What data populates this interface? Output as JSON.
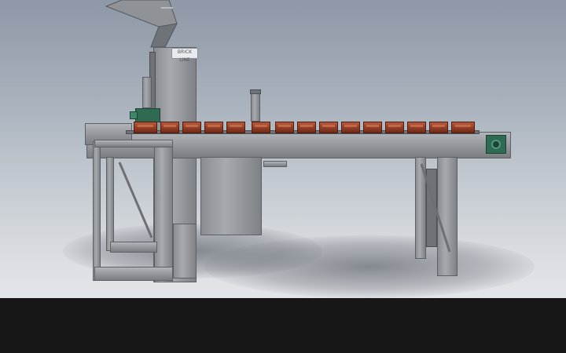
{
  "scene": {
    "description_free": true,
    "model_label": "BRICK LINE",
    "colors": {
      "sky_top": "#8e98a6",
      "sky_bottom": "#e3e6e9",
      "steel": "#9a9da1",
      "brick": "#9a4128",
      "motor_green": "#2f6b52",
      "status_bar": "#171717"
    },
    "icons": [
      "motor-icon",
      "cylinder-icon"
    ]
  }
}
